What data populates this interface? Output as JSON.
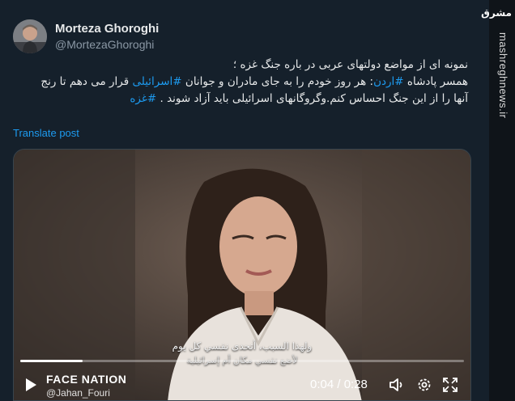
{
  "author": {
    "name": "Morteza Ghoroghi",
    "handle": "@MortezaGhoroghi"
  },
  "post": {
    "line1": "نمونه ای از مواضع دولتهای عربی در باره جنگ غزه ؛",
    "line2_part1": "همسر پادشاه ",
    "line2_tag1": "#اردن",
    "line2_part2": ": هر روز خودم را به جای مادران و جوانان ",
    "line2_tag2": "#اسرائیلی",
    "line2_part3": " قرار می دهم تا رنج",
    "line3_part1": "آنها را از این جنگ احساس کنم.وگروگانهای اسرائیلی باید آزاد شوند . ",
    "line3_tag": "#غزه",
    "translate_label": "Translate post"
  },
  "video": {
    "subtitle_line1": "ولهذا السبب، أتحدى نفسي كل يوم",
    "subtitle_line2": "لأضع نفسي مكان أم إسرائيلية",
    "channel_logo": "FACE NATION",
    "watermark": "@Jahan_Fouri",
    "time_display": "0:04 / 0:28",
    "progress_fraction": 0.14
  },
  "site": {
    "logo_text": "مشرق",
    "url": "mashreghnews.ir"
  },
  "colors": {
    "background": "#15202b",
    "link": "#1d9bf0",
    "muted": "#8b98a5"
  },
  "icons": [
    "play-icon",
    "volume-icon",
    "settings-icon",
    "fullscreen-icon"
  ]
}
